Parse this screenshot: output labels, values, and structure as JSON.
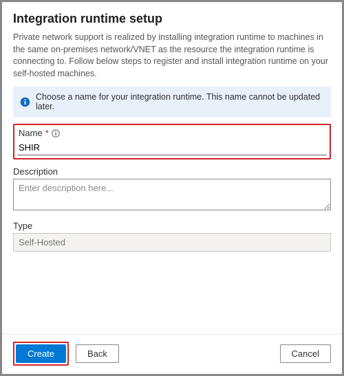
{
  "header": {
    "title": "Integration runtime setup",
    "intro": "Private network support is realized by installing integration runtime to machines in the same on-premises network/VNET as the resource the integration runtime is connecting to. Follow below steps to register and install integration runtime on your self-hosted machines."
  },
  "info": {
    "message": "Choose a name for your integration runtime. This name cannot be updated later."
  },
  "fields": {
    "name": {
      "label": "Name",
      "required_mark": "*",
      "value": "SHIR"
    },
    "description": {
      "label": "Description",
      "placeholder": "Enter description here...",
      "value": ""
    },
    "type": {
      "label": "Type",
      "value": "Self-Hosted"
    }
  },
  "footer": {
    "create": "Create",
    "back": "Back",
    "cancel": "Cancel"
  }
}
